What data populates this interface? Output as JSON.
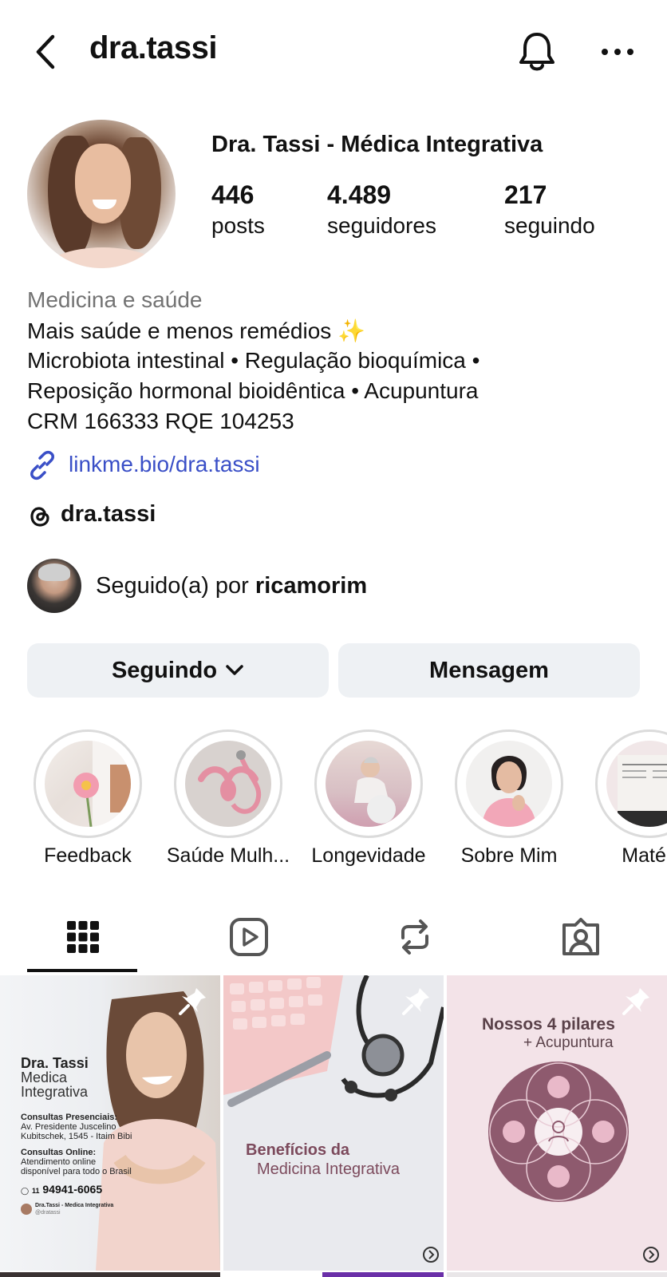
{
  "header": {
    "username": "dra.tassi",
    "icons": [
      "back-icon",
      "bell-icon",
      "more-icon"
    ]
  },
  "profile": {
    "display_name": "Dra. Tassi - Médica Integrativa",
    "stats": [
      {
        "value": "446",
        "label": "posts"
      },
      {
        "value": "4.489",
        "label": "seguidores"
      },
      {
        "value": "217",
        "label": "seguindo"
      }
    ],
    "category": "Medicina e saúde",
    "bio": {
      "line1": "Mais saúde e menos remédios",
      "line1_emoji": "✨",
      "line2": "Microbiota intestinal • Regulação bioquímica •",
      "line3": "Reposição hormonal bioidêntica • Acupuntura",
      "line4": "CRM 166333 RQE 104253"
    },
    "link": "linkme.bio/dra.tassi",
    "threads_handle": "dra.tassi"
  },
  "followed_by": {
    "prefix": "Seguido(a) por ",
    "user": "ricamorim"
  },
  "actions": {
    "following_label": "Seguindo",
    "message_label": "Mensagem"
  },
  "highlights": [
    {
      "label": "Feedback"
    },
    {
      "label": "Saúde Mulh..."
    },
    {
      "label": "Longevidade"
    },
    {
      "label": "Sobre Mim"
    },
    {
      "label": "Matéri"
    }
  ],
  "tabs": [
    "grid-icon",
    "reels-icon",
    "reposts-icon",
    "tagged-icon"
  ],
  "posts": [
    {
      "title": "Dra. Tassi",
      "subtitle1": "Medica",
      "subtitle2": "Integrativa",
      "presencial_label": "Consultas Presenciais:",
      "presencial_addr1": "Av. Presidente Juscelino",
      "presencial_addr2": "Kubitschek, 1545 - Itaim Bibi",
      "online_label": "Consultas Online:",
      "online_line1": "Atendimento online",
      "online_line2": "disponível para todo o Brasil",
      "phone_prefix": "11",
      "phone": "94941-6065",
      "account": "Dra.Tassi - Medica Integrativa",
      "handle": "@dratassi"
    },
    {
      "title1": "Benefícios da",
      "title2": "Medicina Integrativa"
    },
    {
      "title1": "Nossos 4 pilares",
      "title2": "+ Acupuntura"
    }
  ],
  "colors": {
    "link": "#3a4fc7",
    "button_bg": "#eef1f4",
    "muted_text": "#737373",
    "post3_bg": "#f3e3e8",
    "post3_accent": "#8e5a6e"
  }
}
